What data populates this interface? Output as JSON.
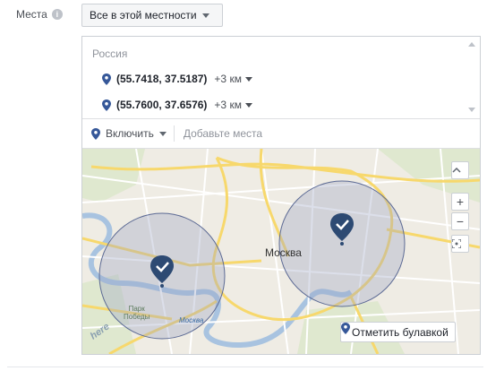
{
  "label": "Места",
  "info_icon": "info-icon",
  "location_type": {
    "selected": "Все в этой местности"
  },
  "country": "Россия",
  "locations": [
    {
      "coords": "(55.7418, 37.5187)",
      "radius": "+3 км"
    },
    {
      "coords": "(55.7600, 37.6576)",
      "radius": "+3 км"
    }
  ],
  "include": {
    "label": "Включить"
  },
  "add_places": {
    "placeholder": "Добавьте места"
  },
  "map": {
    "city": "Москва",
    "park": "Парк\nПобеды",
    "river": "Москва",
    "provider": "here",
    "zoom_in": "+",
    "zoom_out": "−",
    "drop_pin": "Отметить булавкой"
  },
  "colors": {
    "pin": "#365899",
    "circle_fill": "#9aa3c2",
    "road": "#f7d86c"
  }
}
